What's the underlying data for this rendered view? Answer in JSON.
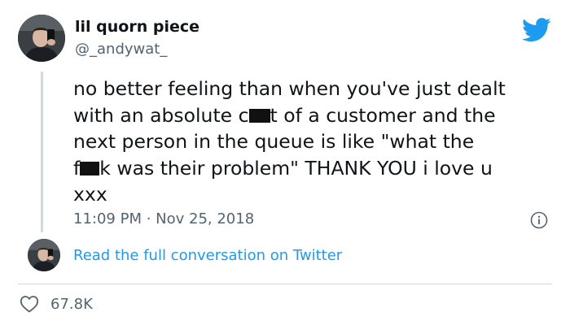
{
  "author": {
    "display_name": "lil quorn piece",
    "handle": "@_andywat_"
  },
  "tweet": {
    "lines": [
      [
        "no better feeling than when you've just dealt",
        ""
      ],
      [
        "with an absolute c",
        "t of a customer and the"
      ],
      [
        "next person in the queue is like \"what the",
        ""
      ],
      [
        "f",
        "k was their problem\" THANK YOU i love u"
      ],
      [
        "xxx",
        ""
      ]
    ],
    "timestamp": "11:09 PM · Nov 25, 2018"
  },
  "conversation_link": "Read the full conversation on Twitter",
  "likes": "67.8K",
  "icons": {
    "brand": "twitter-bird-icon",
    "info": "info-icon",
    "like": "heart-icon"
  },
  "colors": {
    "brand": "#1d9bf0",
    "text": "#0f1419",
    "muted": "#536471",
    "border": "#cfd9de"
  }
}
